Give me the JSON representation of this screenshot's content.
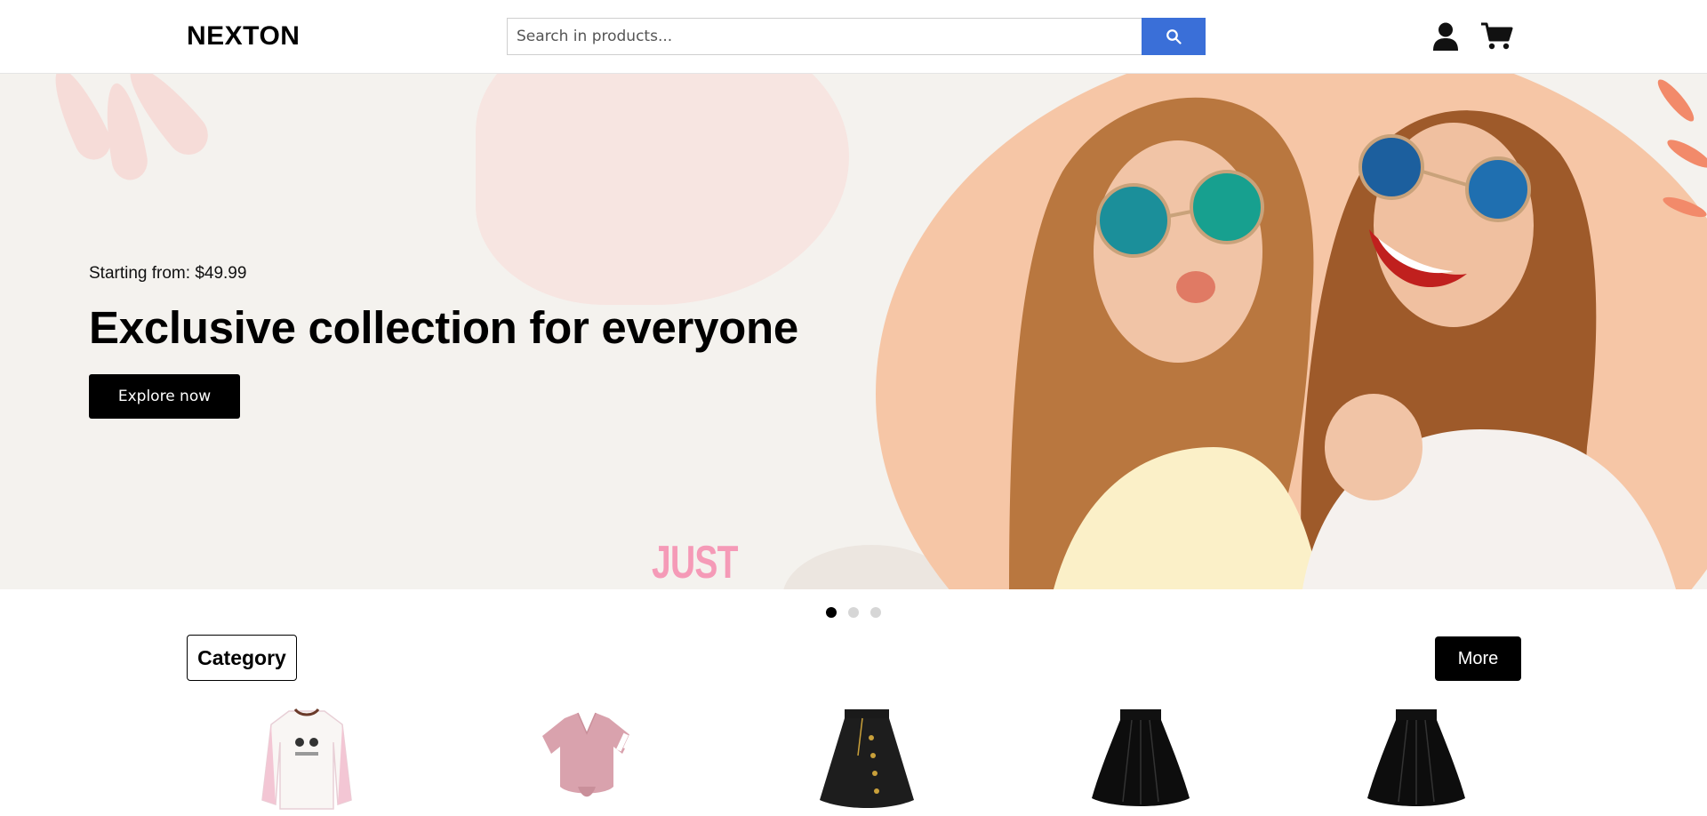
{
  "header": {
    "logo": "NEXTON",
    "search_placeholder": "Search in products..."
  },
  "hero": {
    "subtitle": "Starting from: $49.99",
    "title": "Exclusive collection for everyone",
    "button_label": "Explore now",
    "decor_text": "JUST",
    "slide_count": 3,
    "active_slide": 1
  },
  "category": {
    "title": "Category",
    "more_label": "More",
    "products": [
      {
        "icon": "pink-sweatshirt"
      },
      {
        "icon": "pink-tshirt"
      },
      {
        "icon": "black-skirt-buttons"
      },
      {
        "icon": "black-skirt"
      },
      {
        "icon": "black-skirt"
      }
    ]
  },
  "colors": {
    "accent": "#3a6fd8",
    "hero_bg": "#f4f2ee",
    "hero_circle": "#f6c6a6",
    "primary_button": "#000000"
  }
}
